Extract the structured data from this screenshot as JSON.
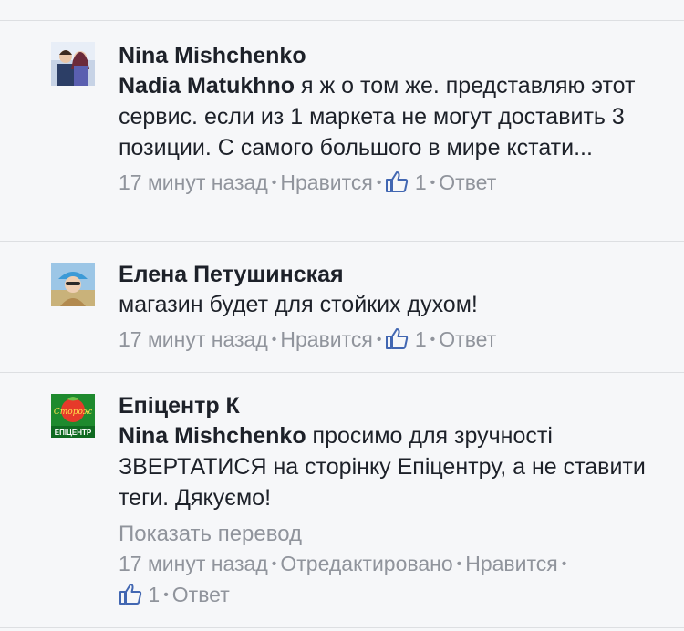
{
  "comments": [
    {
      "author": "Nina Mishchenko",
      "mention": "Nadia Matukhno",
      "text": " я ж о том же. представляю этот сервис. если из 1 маркета не могут доставить 3 позиции. С самого большого в мире кстати...",
      "time": "17 минут назад",
      "like_label": "Нравится",
      "likes": "1",
      "reply_label": "Ответ"
    },
    {
      "author": "Елена Петушинская",
      "text": "магазин будет для стойких духом!",
      "time": "17 минут назад",
      "like_label": "Нравится",
      "likes": "1",
      "reply_label": "Ответ"
    },
    {
      "author": "Епіцентр К",
      "mention": "Nina Mishchenko",
      "text": " просимо для зручності ЗВЕРТАТИСЯ на сторінку Епіцентру, а не ставити теги. Дякуємо!",
      "translate_label": "Показать перевод",
      "time": "17 минут назад",
      "edited_label": "Отредактировано",
      "like_label": "Нравится",
      "likes": "1",
      "reply_label": "Ответ",
      "logo_text": "ЕПІЦЕНТР"
    }
  ],
  "colors": {
    "background": "#f6f7f9",
    "meta": "#90949c",
    "like_icon": "#4267b2",
    "logo_green": "#1e8a2e"
  },
  "icons": [
    "thumbs-up-icon"
  ]
}
